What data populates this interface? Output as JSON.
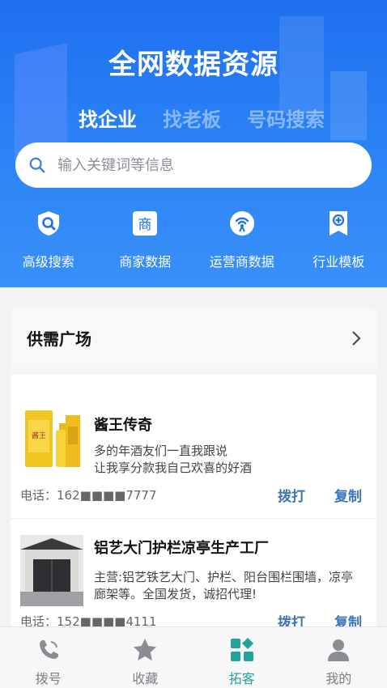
{
  "header": {
    "title": "全网数据资源",
    "tabs": [
      {
        "label": "找企业",
        "active": true
      },
      {
        "label": "找老板",
        "active": false
      },
      {
        "label": "号码搜索",
        "active": false
      }
    ]
  },
  "search": {
    "placeholder": "输入关键词等信息",
    "icon": "search-icon"
  },
  "quick_actions": [
    {
      "label": "高级搜索",
      "icon": "advanced-search-icon"
    },
    {
      "label": "商家数据",
      "icon": "merchant-data-icon"
    },
    {
      "label": "运营商数据",
      "icon": "carrier-data-icon"
    },
    {
      "label": "行业模板",
      "icon": "industry-template-icon"
    }
  ],
  "supply": {
    "title": "供需广场",
    "items": [
      {
        "name": "酱王传奇",
        "description": "多的年酒友们一直我跟说\n让我享分款我自己欢喜的好酒",
        "phone_label": "电话：",
        "phone": "162■■■■7777",
        "dial_label": "拨打",
        "copy_label": "复制",
        "image": "liquor-bottle-image"
      },
      {
        "name": "铝艺大门护栏凉亭生产工厂",
        "description": "主营:铝艺铁艺大门、护栏、阳台围栏围墙，凉亭廊架等。全国发货，诚招代理!",
        "phone_label": "电话：",
        "phone": "152■■■■4111",
        "dial_label": "拨打",
        "copy_label": "复制",
        "image": "gate-image"
      }
    ]
  },
  "tabbar": [
    {
      "label": "拨号",
      "icon": "phone-icon",
      "active": false
    },
    {
      "label": "收藏",
      "icon": "star-icon",
      "active": false
    },
    {
      "label": "拓客",
      "icon": "grid-icon",
      "active": true
    },
    {
      "label": "我的",
      "icon": "user-icon",
      "active": false
    }
  ],
  "colors": {
    "primary": "#1f6ff0",
    "accent": "#22a3a0",
    "link": "#3c74b9"
  }
}
